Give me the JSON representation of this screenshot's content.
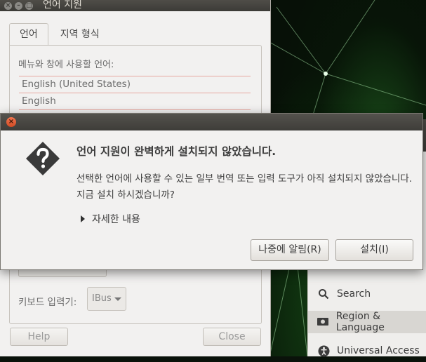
{
  "language_window": {
    "title": "언어 지원",
    "tabs": [
      {
        "label": "언어",
        "active": true
      },
      {
        "label": "지역 형식",
        "active": false
      }
    ],
    "language_list_label": "메뉴와 창에 사용할 언어:",
    "languages": [
      "English (United States)",
      "English"
    ],
    "keyboard_label": "키보드 입력기:",
    "keyboard_value": "IBus",
    "help_label": "Help",
    "close_label": "Close"
  },
  "settings_sidebar": {
    "items": [
      {
        "label": "Search",
        "icon": "search-icon",
        "active": false
      },
      {
        "label": "Region & Language",
        "icon": "flag-icon",
        "active": true
      },
      {
        "label": "Universal Access",
        "icon": "accessibility-icon",
        "active": false
      }
    ]
  },
  "dialog": {
    "heading": "언어 지원이 완벽하게 설치되지 않았습니다.",
    "body": "선택한 언어에 사용할 수 있는 일부 번역 또는 입력 도구가 아직 설치되지 않았습니다. 지금 설치 하시겠습니까?",
    "details_label": "자세한 내용",
    "remind_later_label": "나중에 알림(R)",
    "install_label": "설치(I)"
  },
  "colors": {
    "dialog_close": "#e0592f",
    "titlebar": "#3c3b37",
    "list_divider": "#e8a8a0"
  }
}
